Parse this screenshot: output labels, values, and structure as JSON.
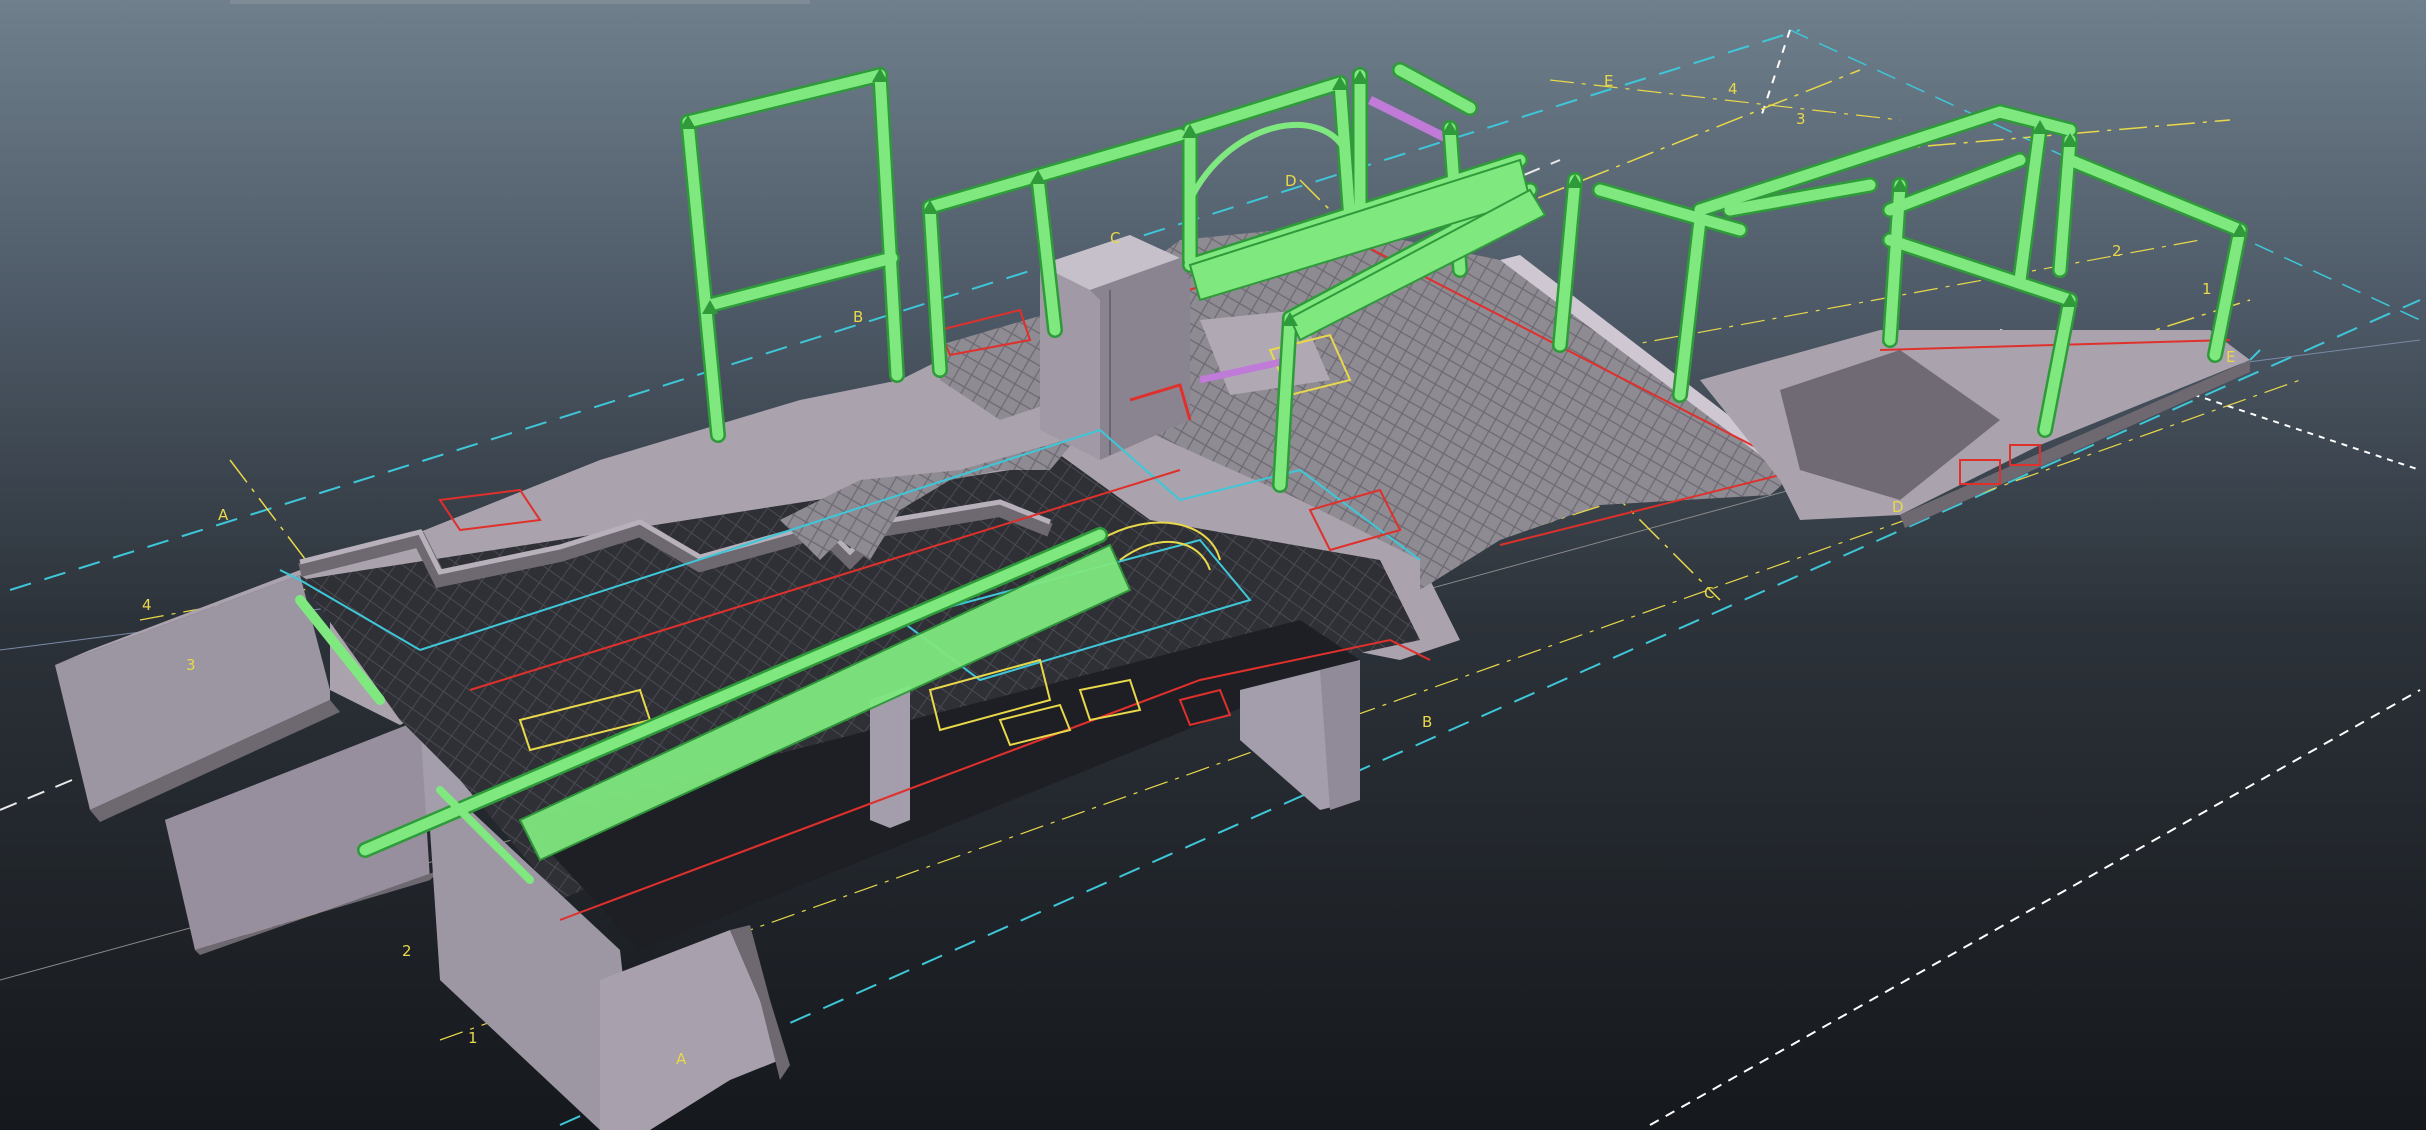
{
  "viewport": {
    "colors": {
      "background_top": "#6f7f8c",
      "background_bottom": "#15181c",
      "floor": "#aaa3ae",
      "floor_shadow": "#6e6870",
      "dark_slab": "#2d2e33",
      "paving": "#8f8b93",
      "structure": "#7fe87f",
      "structure_edge": "#2f9a3a",
      "gridline": "#e8d84a",
      "cyan_line": "#3ec7d8",
      "red_line": "#e0302c",
      "magenta": "#c07ad8"
    }
  },
  "grid_labels": {
    "a1": "A",
    "a2": "A",
    "b1": "B",
    "b2": "B",
    "c1": "C",
    "c2": "C",
    "d1": "D",
    "d2": "D",
    "e1": "E",
    "e2": "E",
    "n1a": "1",
    "n1b": "1",
    "n2a": "2",
    "n2b": "2",
    "n3a": "3",
    "n3b": "3",
    "n4a": "4",
    "n4b": "4"
  }
}
